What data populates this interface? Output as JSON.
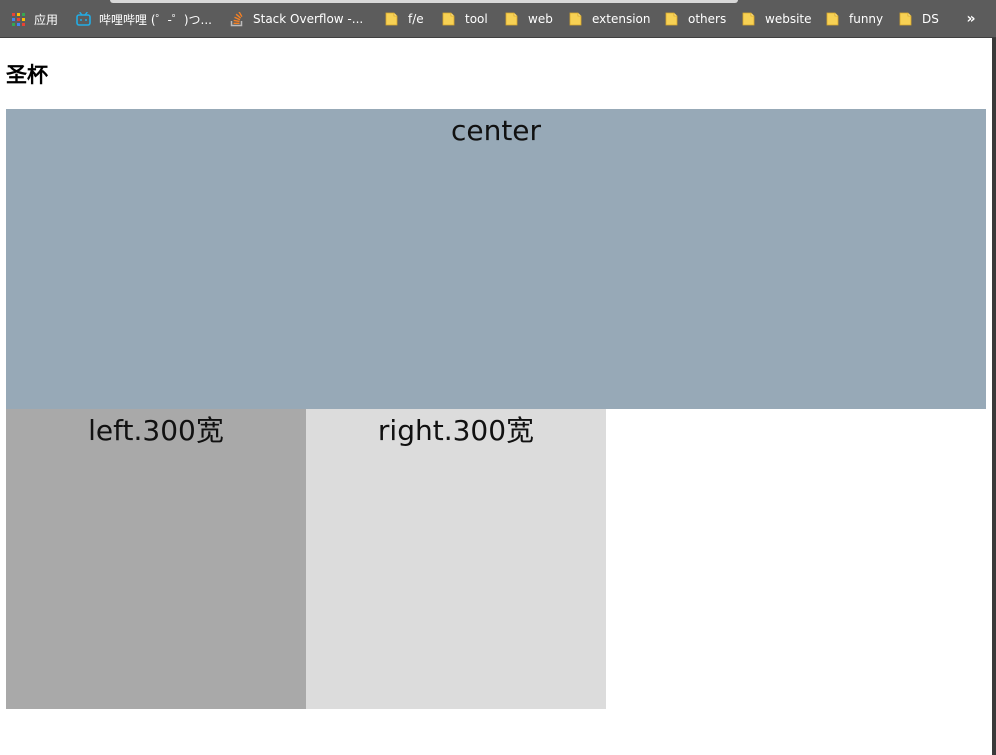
{
  "bookmarks": {
    "apps_label": "应用",
    "items": [
      {
        "label": "哔哩哔哩 (゜-゜)つ...",
        "icon": "bilibili-tv-icon"
      },
      {
        "label": "Stack Overflow -...",
        "icon": "stackoverflow-icon"
      },
      {
        "label": "f/e",
        "icon": "folder-icon"
      },
      {
        "label": "tool",
        "icon": "folder-icon"
      },
      {
        "label": "web",
        "icon": "folder-icon"
      },
      {
        "label": "extension",
        "icon": "folder-icon"
      },
      {
        "label": "others",
        "icon": "folder-icon"
      },
      {
        "label": "website",
        "icon": "folder-icon"
      },
      {
        "label": "funny",
        "icon": "folder-icon"
      },
      {
        "label": "DS",
        "icon": "folder-icon"
      }
    ],
    "more_label": "»"
  },
  "page": {
    "title": "圣杯",
    "center_label": "center",
    "left_label": "left.300宽",
    "right_label": "right.300宽"
  },
  "colors": {
    "center_bg": "#97a9b7",
    "left_bg": "#a9a9a9",
    "right_bg": "#dcdcdc",
    "toolbar_bg": "#5c5c5c",
    "folder_yellow": "#f7d154"
  }
}
